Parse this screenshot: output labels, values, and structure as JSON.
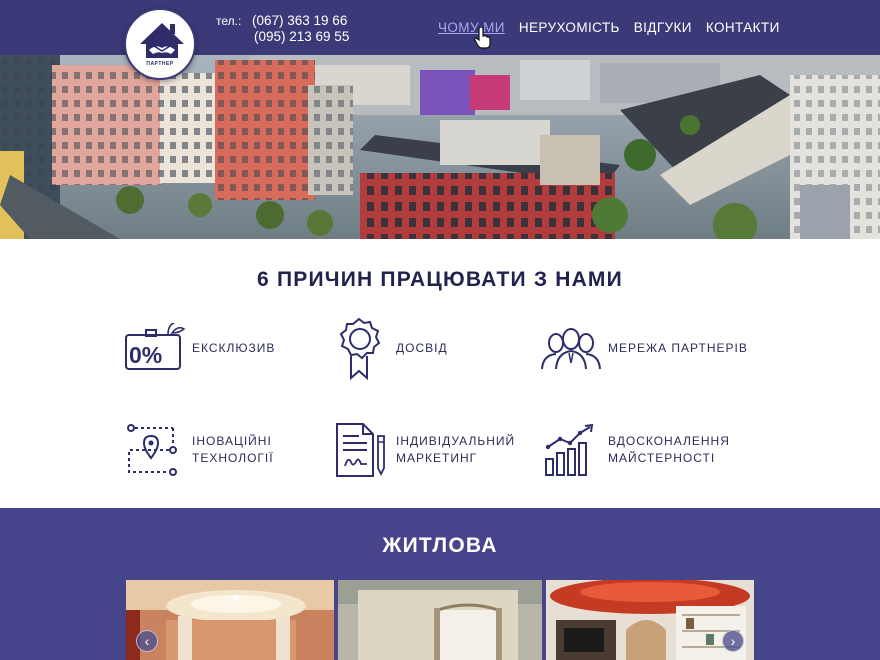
{
  "header": {
    "logo_caption": "ПАРТНЕР",
    "phone_prefix": "тел.:",
    "phones": [
      "(067) 363 19 66",
      "(095) 213 69 55"
    ],
    "nav": [
      {
        "label": "ЧОМУ МИ",
        "active": true
      },
      {
        "label": "НЕРУХОМІСТЬ",
        "active": false
      },
      {
        "label": "ВІДГУКИ",
        "active": false
      },
      {
        "label": "КОНТАКТИ",
        "active": false
      }
    ]
  },
  "reasons": {
    "title": "6 ПРИЧИН ПРАЦЮВАТИ З НАМИ",
    "items": [
      {
        "label": "ЕКСКЛЮЗИВ",
        "icon": "zero-percent-icon"
      },
      {
        "label": "ДОСВІД",
        "icon": "award-ribbon-icon"
      },
      {
        "label": "МЕРЕЖА ПАРТНЕРІВ",
        "icon": "people-group-icon"
      },
      {
        "label": "ІНОВАЦІЙНІ\nТЕХНОЛОГІЇ",
        "icon": "route-map-icon"
      },
      {
        "label": "ІНДИВІДУАЛЬНИЙ\nМАРКЕТИНГ",
        "icon": "document-pen-icon"
      },
      {
        "label": "ВДОСКОНАЛЕННЯ\nМАЙСТЕРНОСТІ",
        "icon": "growth-chart-icon"
      }
    ]
  },
  "residential": {
    "title": "ЖИТЛОВА",
    "prev_icon": "chevron-left-icon",
    "next_icon": "chevron-right-icon",
    "prev_glyph": "‹",
    "next_glyph": "›"
  },
  "colors": {
    "header_bg": "#3b3a78",
    "accent_purple": "#46448a",
    "nav_active": "#a6a8f0",
    "text_dark": "#22224e"
  }
}
